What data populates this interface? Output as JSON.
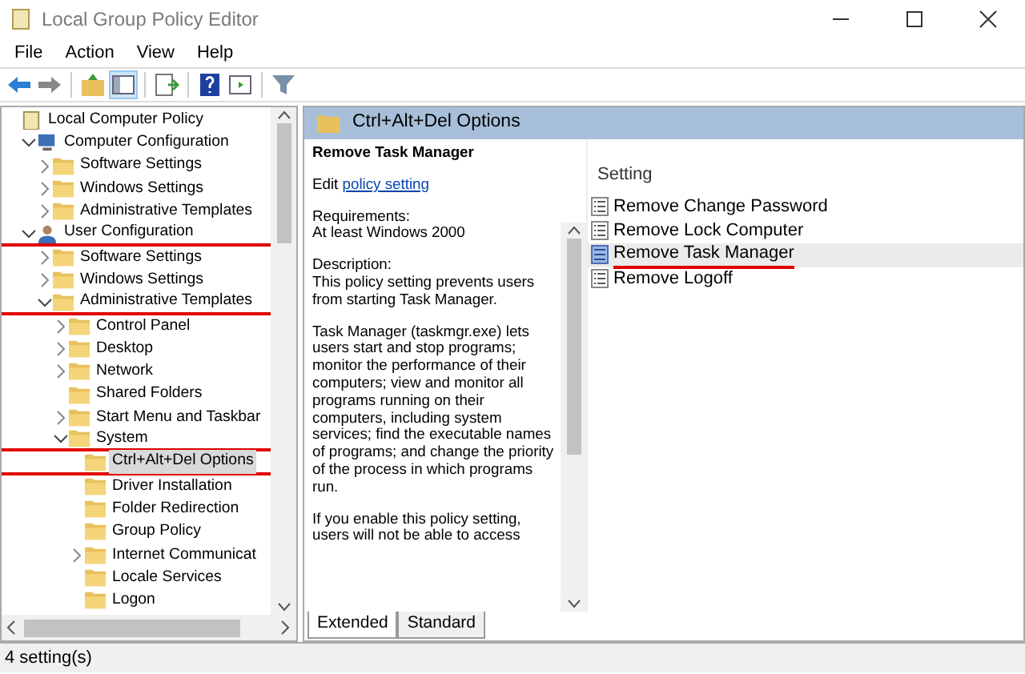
{
  "window": {
    "title": "Local Group Policy Editor"
  },
  "menu": [
    "File",
    "Action",
    "View",
    "Help"
  ],
  "tree": [
    {
      "label": "Local Computer Policy",
      "kind": "policy",
      "selected": false,
      "children": [
        {
          "label": "Computer Configuration",
          "kind": "computer",
          "expanded": true,
          "selected": false,
          "children": [
            {
              "label": "Software Settings",
              "kind": "folder",
              "expanded": false,
              "selected": false
            },
            {
              "label": "Windows Settings",
              "kind": "folder",
              "expanded": false,
              "selected": false
            },
            {
              "label": "Administrative Templates",
              "kind": "folder",
              "expanded": false,
              "selected": false
            }
          ]
        },
        {
          "label": "User Configuration",
          "kind": "user",
          "expanded": true,
          "selected": false,
          "underlined": true,
          "children": [
            {
              "label": "Software Settings",
              "kind": "folder",
              "expanded": false,
              "selected": false
            },
            {
              "label": "Windows Settings",
              "kind": "folder",
              "expanded": false,
              "selected": false
            },
            {
              "label": "Administrative Templates",
              "kind": "folder",
              "expanded": true,
              "selected": false,
              "underlined": true,
              "children": [
                {
                  "label": "Control Panel",
                  "kind": "folder",
                  "expanded": false,
                  "selected": false
                },
                {
                  "label": "Desktop",
                  "kind": "folder",
                  "expanded": false,
                  "selected": false
                },
                {
                  "label": "Network",
                  "kind": "folder",
                  "expanded": false,
                  "selected": false
                },
                {
                  "label": "Shared Folders",
                  "kind": "folder",
                  "selected": false
                },
                {
                  "label": "Start Menu and Taskbar",
                  "kind": "folder",
                  "expanded": false,
                  "selected": false
                },
                {
                  "label": "System",
                  "kind": "folder",
                  "expanded": true,
                  "selected": false,
                  "underlined": true,
                  "children": [
                    {
                      "label": "Ctrl+Alt+Del Options",
                      "kind": "folder",
                      "selected": true,
                      "underlined": true
                    },
                    {
                      "label": "Driver Installation",
                      "kind": "folder",
                      "selected": false
                    },
                    {
                      "label": "Folder Redirection",
                      "kind": "folder",
                      "selected": false
                    },
                    {
                      "label": "Group Policy",
                      "kind": "folder",
                      "selected": false
                    },
                    {
                      "label": "Internet Communicat",
                      "kind": "folder",
                      "expanded": false,
                      "selected": false
                    },
                    {
                      "label": "Locale Services",
                      "kind": "folder",
                      "selected": false
                    },
                    {
                      "label": "Logon",
                      "kind": "folder",
                      "selected": false
                    }
                  ]
                }
              ]
            }
          ]
        }
      ]
    }
  ],
  "header": {
    "title": "Ctrl+Alt+Del Options"
  },
  "description": {
    "title": "Remove Task Manager",
    "edit_prefix": "Edit",
    "edit_link": "policy setting",
    "paragraphs": [
      "Requirements:\nAt least Windows 2000",
      "Description:\nThis policy setting prevents users from starting Task Manager.",
      "Task Manager (taskmgr.exe) lets users start and stop programs; monitor the performance of their computers; view and monitor all programs running on their computers, including system services; find the executable names of programs; and change the priority of the process in which programs run.",
      "If you enable this policy setting, users will not be able to access"
    ]
  },
  "settings": {
    "column": "Setting",
    "rows": [
      {
        "label": "Remove Change Password",
        "selected": false
      },
      {
        "label": "Remove Lock Computer",
        "selected": false
      },
      {
        "label": "Remove Task Manager",
        "selected": true,
        "underlined": true
      },
      {
        "label": "Remove Logoff",
        "selected": false
      }
    ]
  },
  "tabs": [
    {
      "label": "Extended",
      "selected": true
    },
    {
      "label": "Standard",
      "selected": false
    }
  ],
  "status_bar": "4 setting(s)"
}
